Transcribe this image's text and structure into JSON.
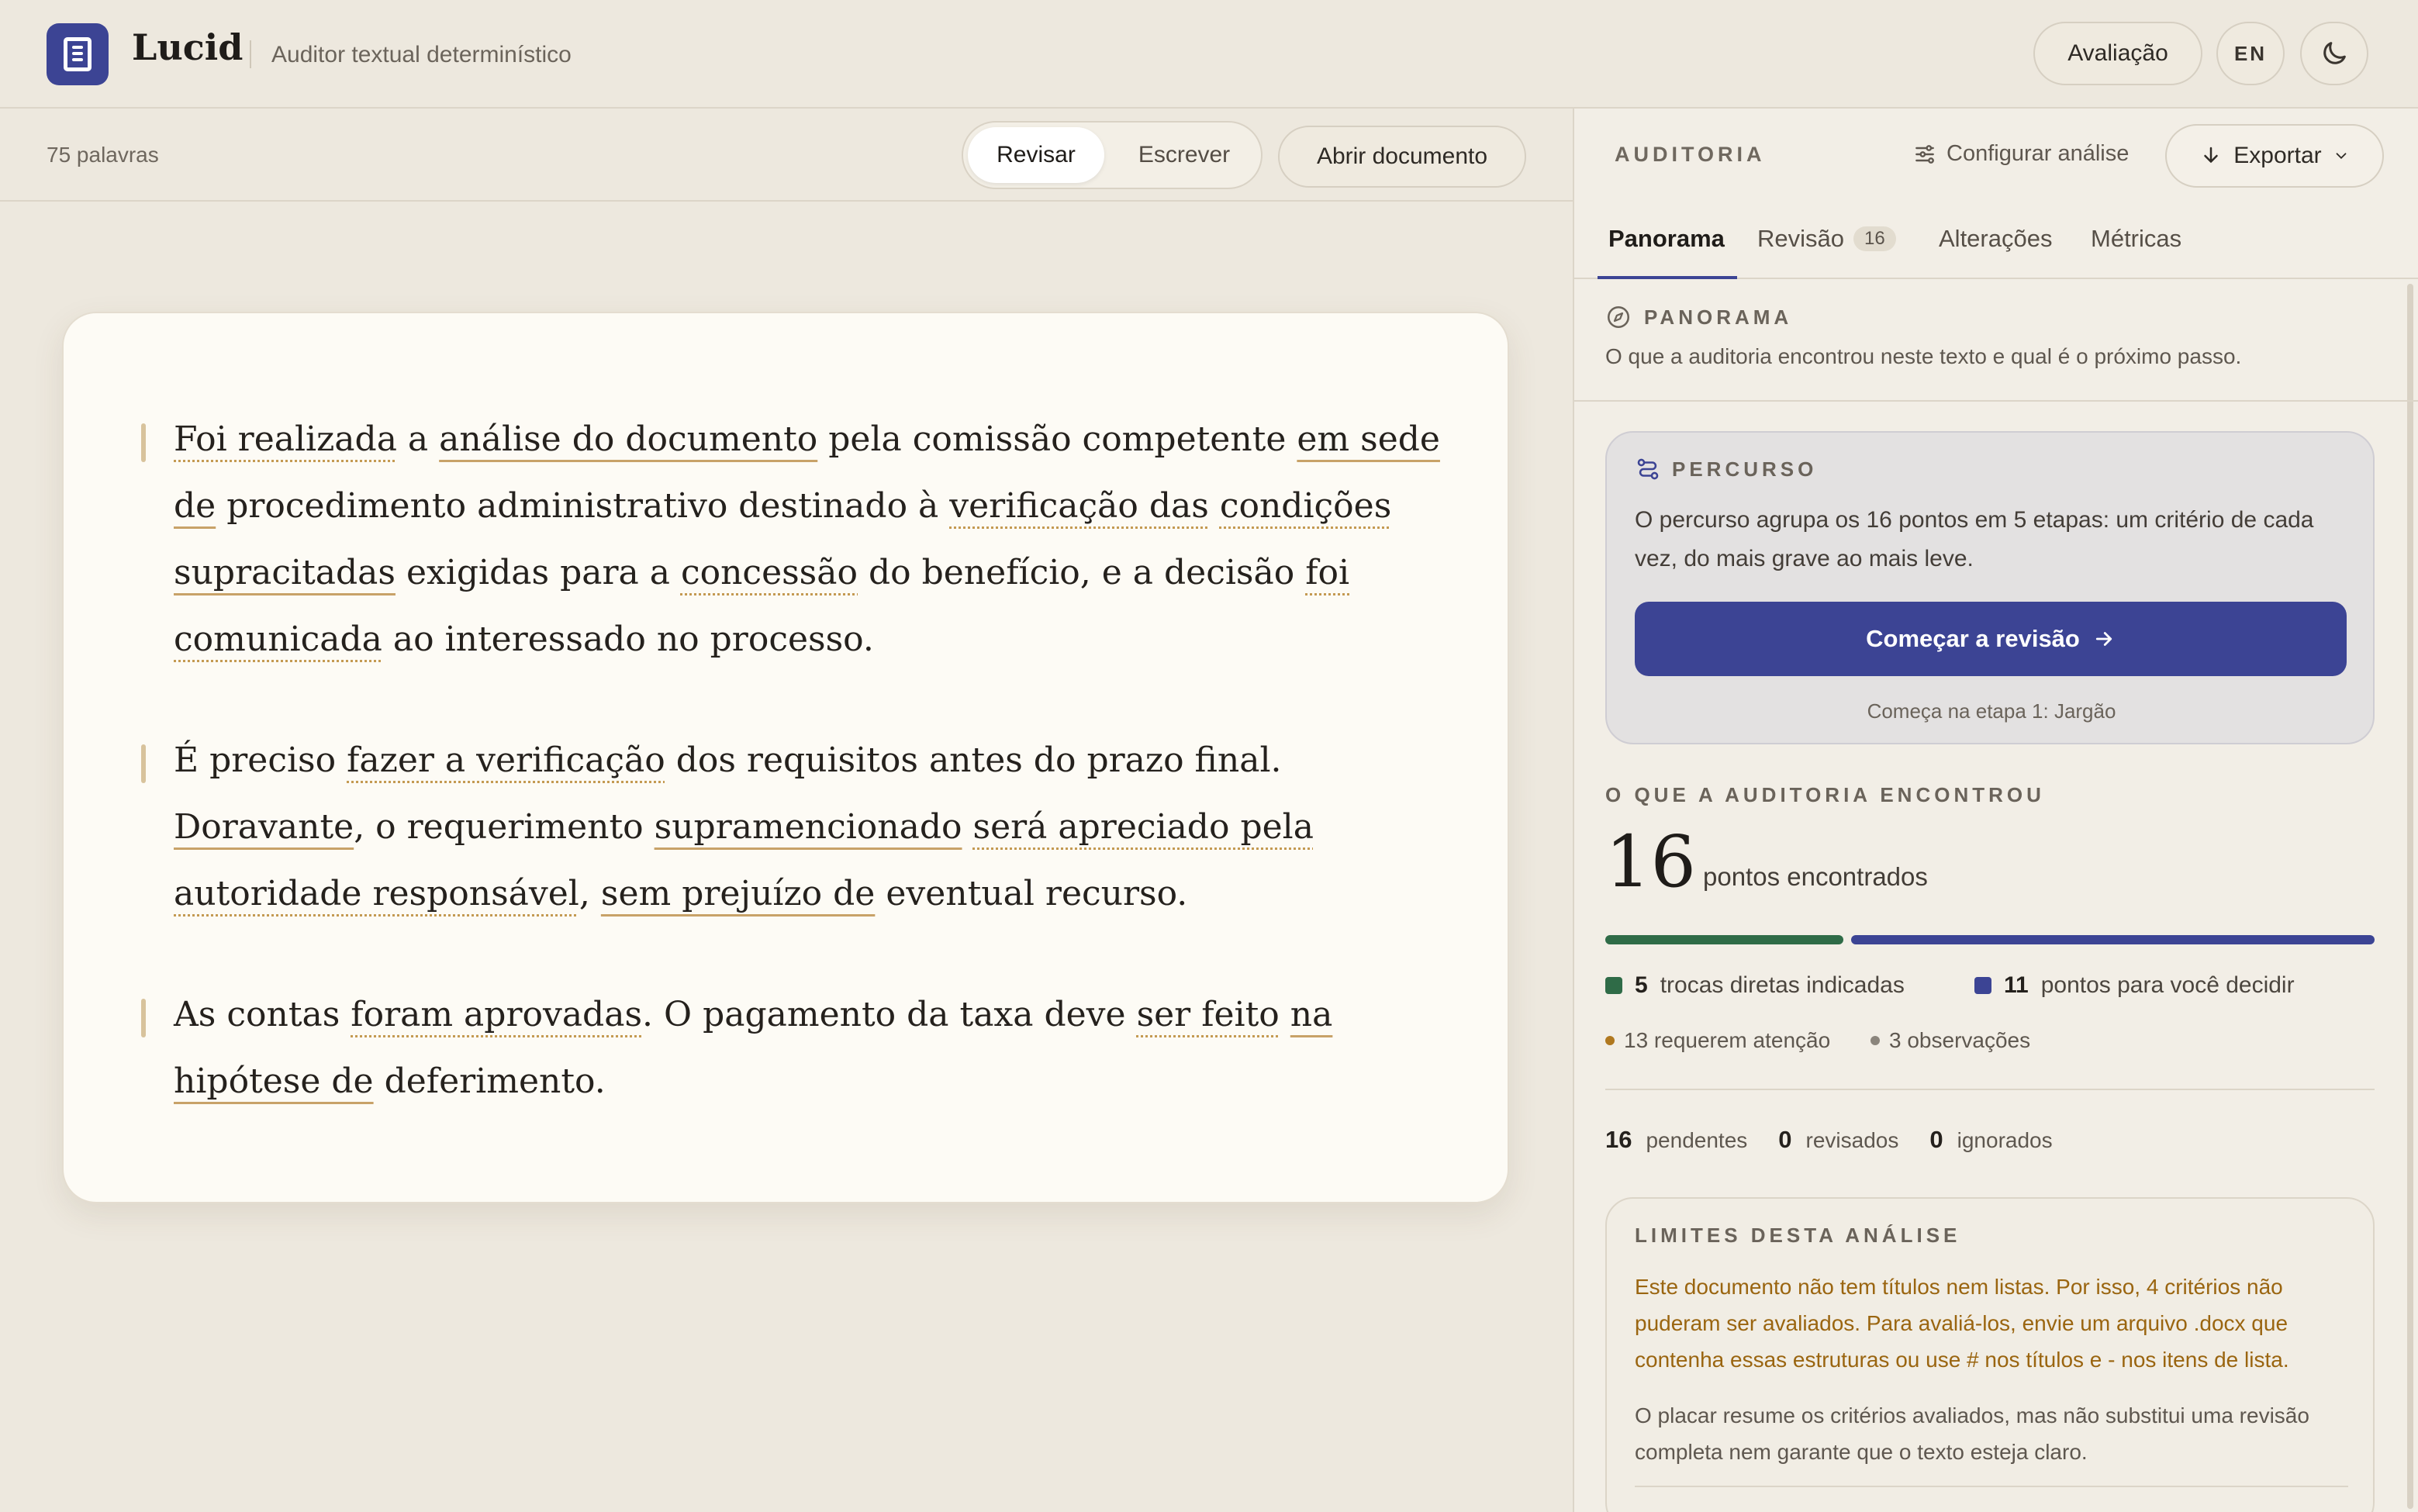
{
  "app": {
    "name": "Lucid",
    "subtitle": "Auditor textual determinístico",
    "evaluation_label": "Avaliação",
    "language_label": "EN",
    "theme_icon": "moon-icon",
    "logo_icon": "document-icon"
  },
  "editor": {
    "word_count": "75 palavras",
    "modes": {
      "review": "Revisar",
      "write": "Escrever"
    },
    "open_label": "Abrir documento",
    "paragraphs": [
      {
        "segments": [
          {
            "text": "Foi realizada",
            "style": "dot"
          },
          {
            "text": " a ",
            "style": "none"
          },
          {
            "text": "análise do documento",
            "style": "solid"
          },
          {
            "text": " pela comissão competente ",
            "style": "none"
          },
          {
            "text": "em sede de",
            "style": "solid"
          },
          {
            "text": " procedimento administrativo destinado à ",
            "style": "none"
          },
          {
            "text": "verificação das",
            "style": "dot"
          },
          {
            "text": " ",
            "style": "none"
          },
          {
            "text": "condições",
            "style": "dot"
          },
          {
            "text": " ",
            "style": "none"
          },
          {
            "text": "supracitadas",
            "style": "solid"
          },
          {
            "text": " exigidas para a ",
            "style": "none"
          },
          {
            "text": "concessão",
            "style": "dot"
          },
          {
            "text": " do benefício, e a decisão ",
            "style": "none"
          },
          {
            "text": "foi comunicada",
            "style": "dot"
          },
          {
            "text": " ao interessado no processo.",
            "style": "none"
          }
        ]
      },
      {
        "segments": [
          {
            "text": "É preciso ",
            "style": "none"
          },
          {
            "text": "fazer a verificação",
            "style": "dot"
          },
          {
            "text": " dos requisitos antes do prazo final. ",
            "style": "none"
          },
          {
            "text": "Doravante",
            "style": "solid"
          },
          {
            "text": ", o requerimento ",
            "style": "none"
          },
          {
            "text": "supramencionado",
            "style": "solid"
          },
          {
            "text": " ",
            "style": "none"
          },
          {
            "text": "será apreciado pela autoridade responsável",
            "style": "dot"
          },
          {
            "text": ", ",
            "style": "none"
          },
          {
            "text": "sem prejuízo de",
            "style": "solid"
          },
          {
            "text": " eventual recurso.",
            "style": "none"
          }
        ]
      },
      {
        "segments": [
          {
            "text": "As contas ",
            "style": "none"
          },
          {
            "text": "foram aprovadas",
            "style": "dot"
          },
          {
            "text": ". O pagamento da taxa deve ",
            "style": "none"
          },
          {
            "text": "ser feito",
            "style": "dot"
          },
          {
            "text": " ",
            "style": "none"
          },
          {
            "text": "na hipótese de",
            "style": "solid"
          },
          {
            "text": " deferimento.",
            "style": "none"
          }
        ]
      }
    ]
  },
  "panel": {
    "title": "AUDITORIA",
    "configure_label": "Configurar análise",
    "export_label": "Exportar",
    "tabs": [
      {
        "label": "Panorama",
        "badge": ""
      },
      {
        "label": "Revisão",
        "badge": "16"
      },
      {
        "label": "Alterações",
        "badge": ""
      },
      {
        "label": "Métricas",
        "badge": ""
      }
    ],
    "overview": {
      "label": "PANORAMA",
      "description": "O que a auditoria encontrou neste texto e qual é o próximo passo."
    },
    "route": {
      "label": "PERCURSO",
      "text": "O percurso agrupa os 16 pontos em 5 etapas: um critério de cada vez, do mais grave ao mais leve.",
      "start_label": "Começar a revisão",
      "hint": "Começa na etapa 1: Jargão"
    },
    "findings": {
      "label": "O QUE A AUDITORIA ENCONTROU",
      "total": "16",
      "total_label": "pontos encontrados",
      "direct": {
        "count": "5",
        "label": "trocas diretas indicadas",
        "fraction": 0.3125,
        "color": "#2f6b47"
      },
      "decide": {
        "count": "11",
        "label": "pontos para você decidir",
        "fraction": 0.6875,
        "color": "#3c4494"
      },
      "attention": "13 requerem atenção",
      "observations": "3 observações"
    },
    "status": {
      "pending": {
        "count": "16",
        "label": "pendentes"
      },
      "reviewed": {
        "count": "0",
        "label": "revisados"
      },
      "ignored": {
        "count": "0",
        "label": "ignorados"
      }
    },
    "limits": {
      "label": "LIMITES DESTA ANÁLISE",
      "warning": "Este documento não tem títulos nem listas. Por isso, 4 critérios não puderam ser avaliados. Para avaliá-los, envie um arquivo .docx que contenha essas estruturas ou use # nos títulos e - nos itens de lista.",
      "note": "O placar resume os critérios avaliados, mas não substitui uma revisão completa nem garante que o texto esteja claro."
    }
  }
}
